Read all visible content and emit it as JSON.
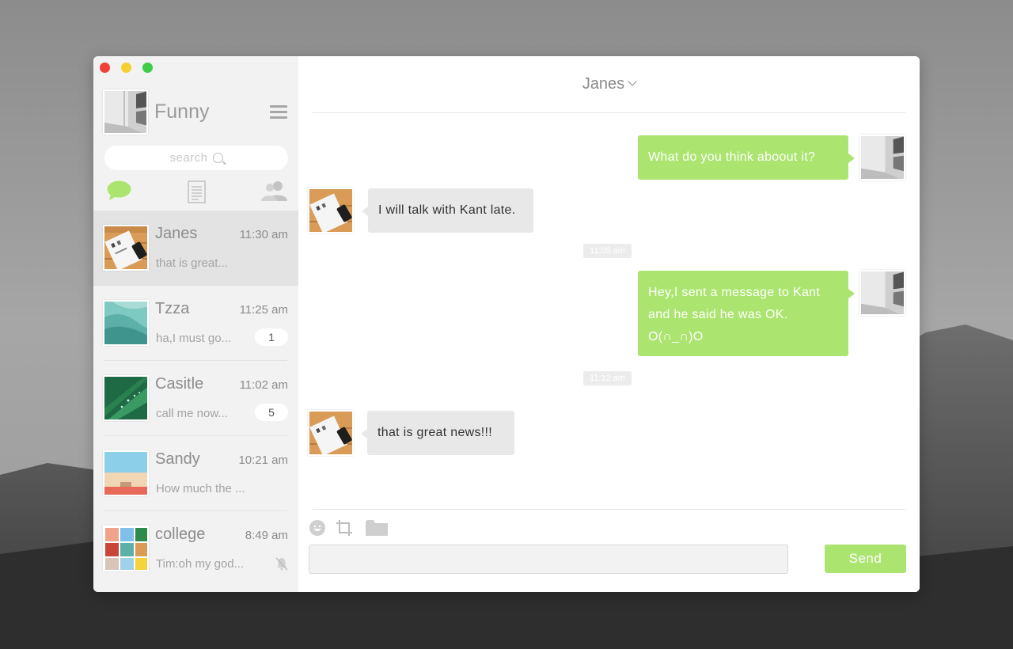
{
  "colors": {
    "accent_green": "#abe56f",
    "sidebar_bg": "#f2f2f2",
    "active_item_bg": "#e3e3e3",
    "incoming_bubble": "#e8e8e8"
  },
  "sidebar": {
    "profile_name": "Funny",
    "search_placeholder": "search",
    "tabs": [
      "chat-icon",
      "document-icon",
      "contacts-icon"
    ],
    "conversations": [
      {
        "name": "Janes",
        "time": "11:30 am",
        "preview": "that is great...",
        "badge": "",
        "active": true,
        "muted": false
      },
      {
        "name": "Tzza",
        "time": "11:25 am",
        "preview": "ha,I must go...",
        "badge": "1",
        "active": false,
        "muted": false
      },
      {
        "name": "Casitle",
        "time": "11:02 am",
        "preview": "call me now...",
        "badge": "5",
        "active": false,
        "muted": false
      },
      {
        "name": "Sandy",
        "time": "10:21 am",
        "preview": "How much the ...",
        "badge": "",
        "active": false,
        "muted": false
      },
      {
        "name": "college",
        "time": "8:49 am",
        "preview": "Tim:oh my god...",
        "badge": "",
        "active": false,
        "muted": true
      }
    ]
  },
  "chat": {
    "title": "Janes",
    "messages": [
      {
        "direction": "out",
        "text": "What do you think aboout it?"
      },
      {
        "direction": "in",
        "text": "I will talk with Kant late."
      },
      {
        "type": "timestamp",
        "text": "11:05 am"
      },
      {
        "direction": "out",
        "text": "Hey,I sent a message to Kant and he said he was OK. O(∩_∩)O"
      },
      {
        "type": "timestamp",
        "text": "11:12 am"
      },
      {
        "direction": "in",
        "text": "that is great news!!!"
      }
    ],
    "toolbar": [
      "emoji-icon",
      "crop-icon",
      "folder-icon"
    ],
    "input_value": "",
    "send_label": "Send"
  }
}
